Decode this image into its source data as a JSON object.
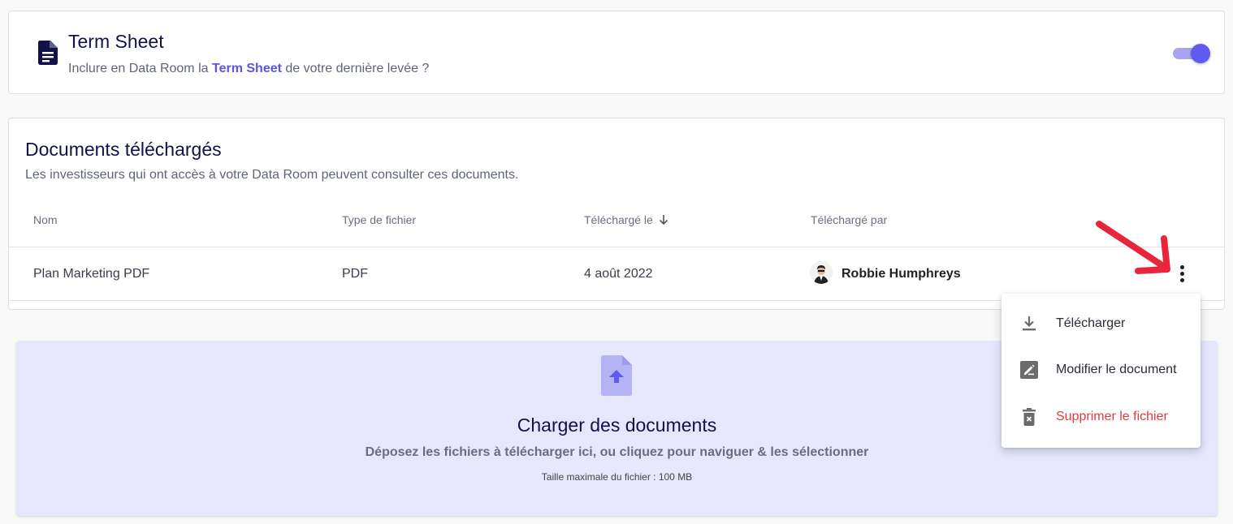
{
  "term_sheet": {
    "title": "Term Sheet",
    "subtitle_before": "Inclure en Data Room la ",
    "subtitle_highlight": "Term Sheet",
    "subtitle_after": " de votre dernière levée ?",
    "toggle_on": true,
    "icon": "document-icon"
  },
  "documents": {
    "title": "Documents téléchargés",
    "subtitle": "Les investisseurs qui ont accès à votre Data Room peuvent consulter ces documents.",
    "columns": {
      "name": "Nom",
      "type": "Type de fichier",
      "date": "Téléchargé le",
      "by": "Téléchargé par"
    },
    "rows": [
      {
        "name": "Plan Marketing PDF",
        "type": "PDF",
        "date": "4 août 2022",
        "by": "Robbie Humphreys"
      }
    ]
  },
  "upload": {
    "title": "Charger des documents",
    "subtitle": "Déposez les fichiers à télécharger ici, ou cliquez pour naviguer & les sélectionner",
    "size_note": "Taille maximale du fichier : 100 MB",
    "icon": "file-upload-icon"
  },
  "menu": {
    "items": [
      {
        "label": "Télécharger",
        "icon": "download-icon"
      },
      {
        "label": "Modifier le document",
        "icon": "edit-icon"
      },
      {
        "label": "Supprimer le fichier",
        "icon": "delete-icon"
      }
    ]
  },
  "colors": {
    "accent": "#5f5af0",
    "danger": "#e53a3a",
    "annotation_arrow": "#e8253a"
  }
}
